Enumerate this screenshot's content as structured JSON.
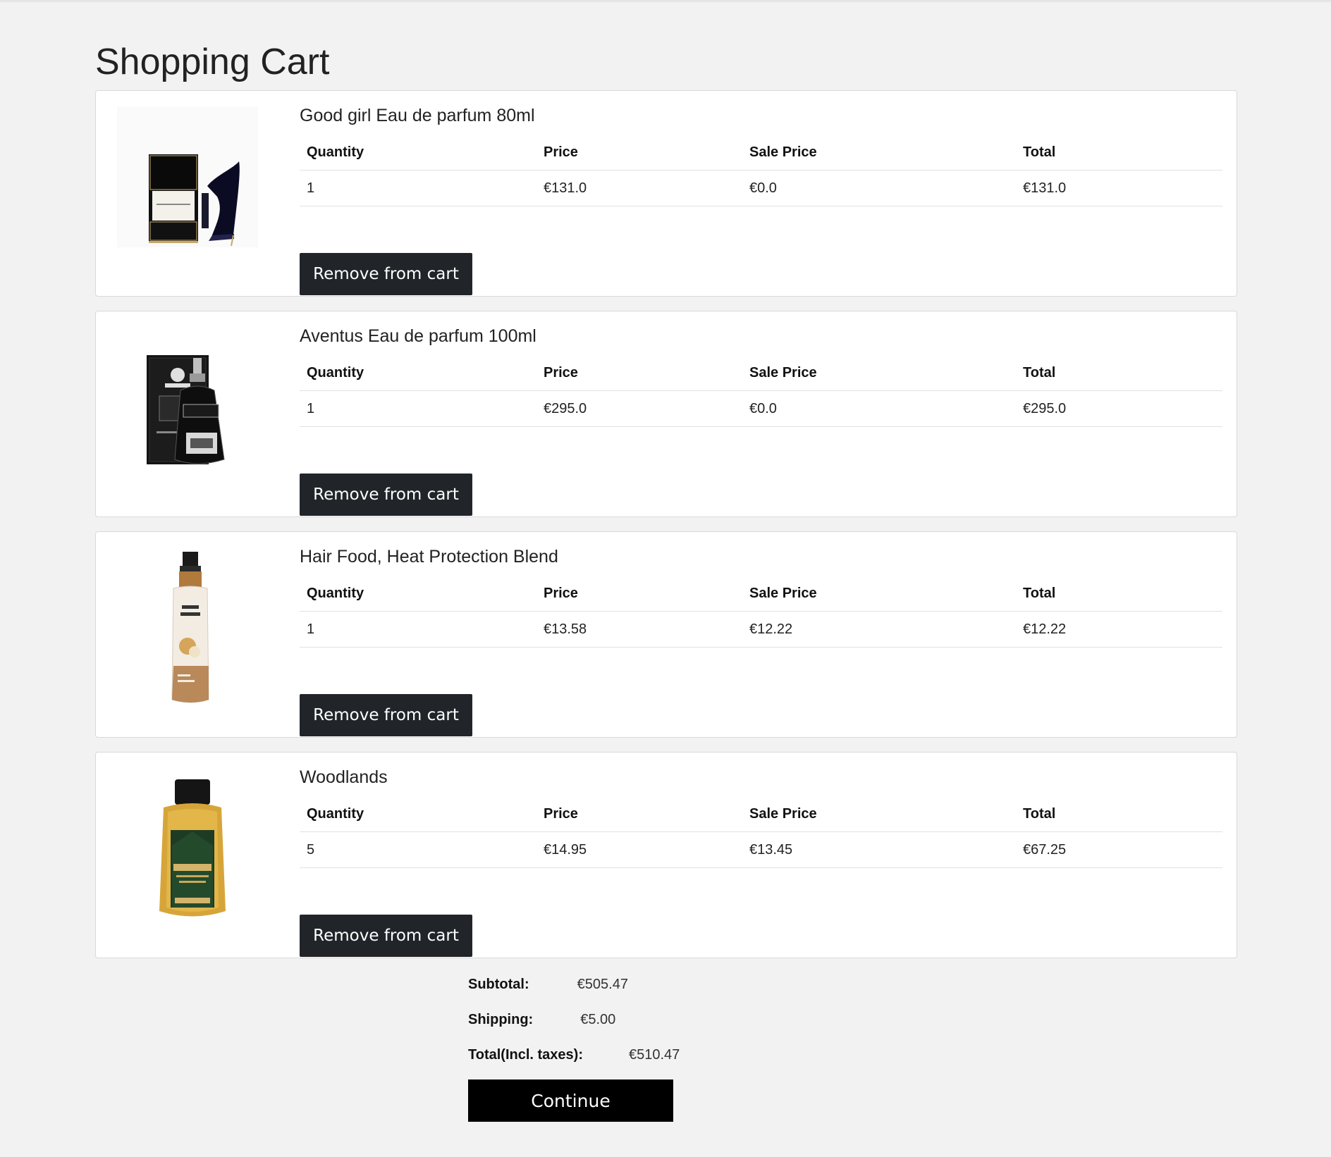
{
  "page": {
    "title": "Shopping Cart"
  },
  "table_headers": {
    "quantity": "Quantity",
    "price": "Price",
    "sale_price": "Sale Price",
    "total": "Total"
  },
  "cart_items": [
    {
      "name": "Good girl Eau de parfum 80ml",
      "quantity": "1",
      "price": "€131.0",
      "sale_price": "€0.0",
      "total": "€131.0",
      "remove_label": "Remove from cart",
      "image_icon": "perfume-bottle-and-box"
    },
    {
      "name": "Aventus Eau de parfum 100ml",
      "quantity": "1",
      "price": "€295.0",
      "sale_price": "€0.0",
      "total": "€295.0",
      "remove_label": "Remove from cart",
      "image_icon": "perfume-bottle-and-box"
    },
    {
      "name": "Hair Food, Heat Protection Blend",
      "quantity": "1",
      "price": "€13.58",
      "sale_price": "€12.22",
      "total": "€12.22",
      "remove_label": "Remove from cart",
      "image_icon": "spray-bottle"
    },
    {
      "name": "Woodlands",
      "quantity": "5",
      "price": "€14.95",
      "sale_price": "€13.45",
      "total": "€67.25",
      "remove_label": "Remove from cart",
      "image_icon": "body-wash-bottle"
    }
  ],
  "summary": {
    "subtotal_label": "Subtotal:",
    "subtotal_value": "€505.47",
    "shipping_label": "Shipping:",
    "shipping_value": "€5.00",
    "total_label": "Total(Incl. taxes):",
    "total_value": "€510.47"
  },
  "actions": {
    "continue_label": "Continue"
  },
  "colors": {
    "page_background": "#f2f2f2",
    "card_background": "#ffffff",
    "remove_button": "#212529",
    "continue_button": "#000000"
  }
}
